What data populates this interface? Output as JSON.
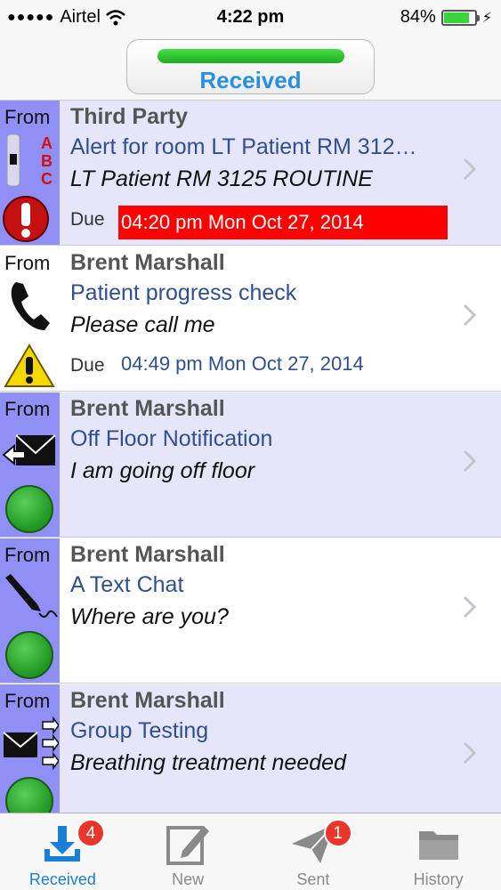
{
  "status": {
    "carrier": "Airtel",
    "time": "4:22 pm",
    "battery": "84%",
    "battery_level": 0.84
  },
  "header": {
    "title": "Received",
    "accent": "#2b8fe0"
  },
  "messages": [
    {
      "from_label": "From",
      "sender": "Third Party",
      "subject": "Alert for room LT Patient RM 312…",
      "body": "LT Patient RM 3125 ROUTINE",
      "due_label": "Due",
      "due": "04:20 pm Mon Oct 27, 2014",
      "overdue": true,
      "priority_icon": "exclamation-icon",
      "type_icon": "abc-slider-icon"
    },
    {
      "from_label": "From",
      "sender": "Brent Marshall",
      "subject": "Patient progress check",
      "body": "Please call me",
      "due_label": "Due",
      "due": "04:49 pm Mon Oct 27, 2014",
      "overdue": false,
      "priority_icon": "warning-icon",
      "type_icon": "phone-icon"
    },
    {
      "from_label": "From",
      "sender": "Brent Marshall",
      "subject": "Off Floor Notification",
      "body": "I am going off floor",
      "priority_icon": "green-status-icon",
      "type_icon": "envelope-reply-icon"
    },
    {
      "from_label": "From",
      "sender": "Brent Marshall",
      "subject": "A Text Chat",
      "body": "Where are you?",
      "priority_icon": "green-status-icon",
      "type_icon": "pen-icon"
    },
    {
      "from_label": "From",
      "sender": "Brent Marshall",
      "subject": "Group Testing",
      "body": "Breathing treatment needed",
      "priority_icon": "green-status-icon",
      "type_icon": "envelope-group-icon"
    }
  ],
  "tabs": [
    {
      "label": "Received",
      "badge": "4",
      "icon": "download-tray-icon",
      "active": true
    },
    {
      "label": "New",
      "icon": "compose-icon",
      "active": false
    },
    {
      "label": "Sent",
      "badge": "1",
      "icon": "paper-plane-icon",
      "active": false
    },
    {
      "label": "History",
      "icon": "folder-icon",
      "active": false
    }
  ],
  "colors": {
    "overdue": "#ff0000",
    "tab_active": "#1a7fd6",
    "badge": "#e8362b"
  }
}
